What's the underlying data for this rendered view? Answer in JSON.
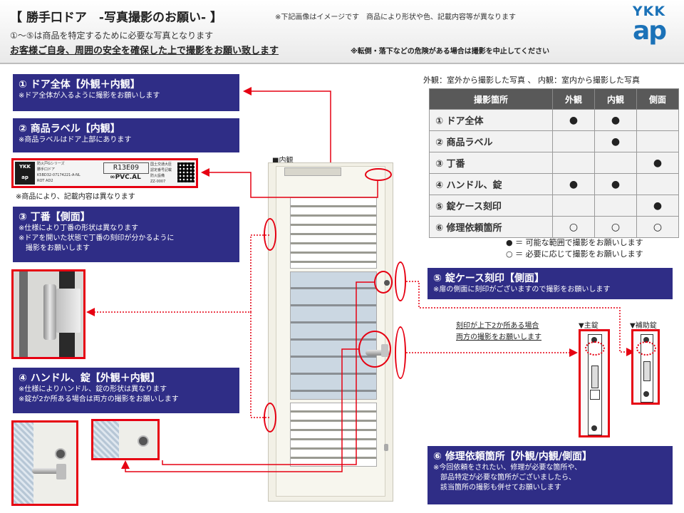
{
  "header": {
    "title": "【 勝手口ドア　-写真撮影のお願い- 】",
    "title_note": "※下記画像はイメージです　商品により形状や色、記載内容等が異なります",
    "subtitle1": "①～⑤は商品を特定するために必要な写真となります",
    "subtitle2": "お客様ご自身、周囲の安全を確保した上で撮影をお願い致します",
    "subtitle2_note": "※転倒・落下などの危険がある場合は撮影を中止してください",
    "logo_top": "YKK",
    "logo_bottom": "ap"
  },
  "boxes": {
    "b1": {
      "title": "① ドア全体【外観＋内観】",
      "note": "※ドア全体が入るように撮影をお願いします"
    },
    "b2": {
      "title": "② 商品ラベル【内観】",
      "note": "※商品ラベルはドア上部にあります"
    },
    "b3": {
      "title": "③ 丁番【側面】",
      "note1": "※仕様により丁番の形状は異なります",
      "note2": "※ドアを開いた状態で丁番の刻印が分かるように",
      "note3": "　撮影をお願いします"
    },
    "b4": {
      "title": "④ ハンドル、錠【外観＋内観】",
      "note1": "※仕様によりハンドル、錠の形状は異なります",
      "note2": "※錠が2か所ある場合は両方の撮影をお願いします"
    },
    "b5": {
      "title": "⑤ 錠ケース刻印【側面】",
      "note": "※扉の側面に刻印がございますので撮影をお願いします"
    },
    "b6": {
      "title": "⑥ 修理依頼箇所【外観/内観/側面】",
      "note1": "※今回依頼をされたい、修理が必要な箇所や、",
      "note2": "　部品特定が必要な箇所がございましたら、",
      "note3": "　該当箇所の撮影も併せてお願いします"
    }
  },
  "label_sample": {
    "logo": "YKK ap",
    "lines": [
      "防火戸Gシリーズ",
      "勝手口ドア",
      "K5BD32-07174221-A-NL",
      "ROT AD2"
    ],
    "code": "R13E09",
    "pvc": "∞PVC.AL",
    "zz": "ZZ-0007",
    "side": [
      "国土交通大臣",
      "認定番号記載",
      "防火設備"
    ]
  },
  "label_note": "※商品により、記載内容は異なります",
  "inner_view_label": "■内観",
  "legend_top": "外観：室外から撮影した写真 、 内観：室内から撮影した写真",
  "table": {
    "headers": [
      "撮影箇所",
      "外観",
      "内観",
      "側面"
    ],
    "rows": [
      {
        "label": "① ドア全体",
        "cells": [
          "●",
          "●",
          ""
        ]
      },
      {
        "label": "② 商品ラベル",
        "cells": [
          "",
          "●",
          ""
        ]
      },
      {
        "label": "③ 丁番",
        "cells": [
          "",
          "",
          "●"
        ]
      },
      {
        "label": "④ ハンドル、錠",
        "cells": [
          "●",
          "●",
          ""
        ]
      },
      {
        "label": "⑤ 錠ケース刻印",
        "cells": [
          "",
          "",
          "●"
        ]
      },
      {
        "label": "⑥ 修理依頼箇所",
        "cells": [
          "○",
          "○",
          "○"
        ]
      }
    ]
  },
  "legend": {
    "filled": "● ＝ 可能な範囲で撮影をお願いします",
    "open": "○ ＝ 必要に応じて撮影をお願いします"
  },
  "lock_note1": "刻印が上下2か所ある場合",
  "lock_note2": "両方の撮影をお願いします",
  "main_lock_label": "▼主錠",
  "aux_lock_label": "▼補助錠",
  "colors": {
    "navy": "#2f2d86",
    "red": "#e60012",
    "brand_blue": "#1b72b8"
  }
}
